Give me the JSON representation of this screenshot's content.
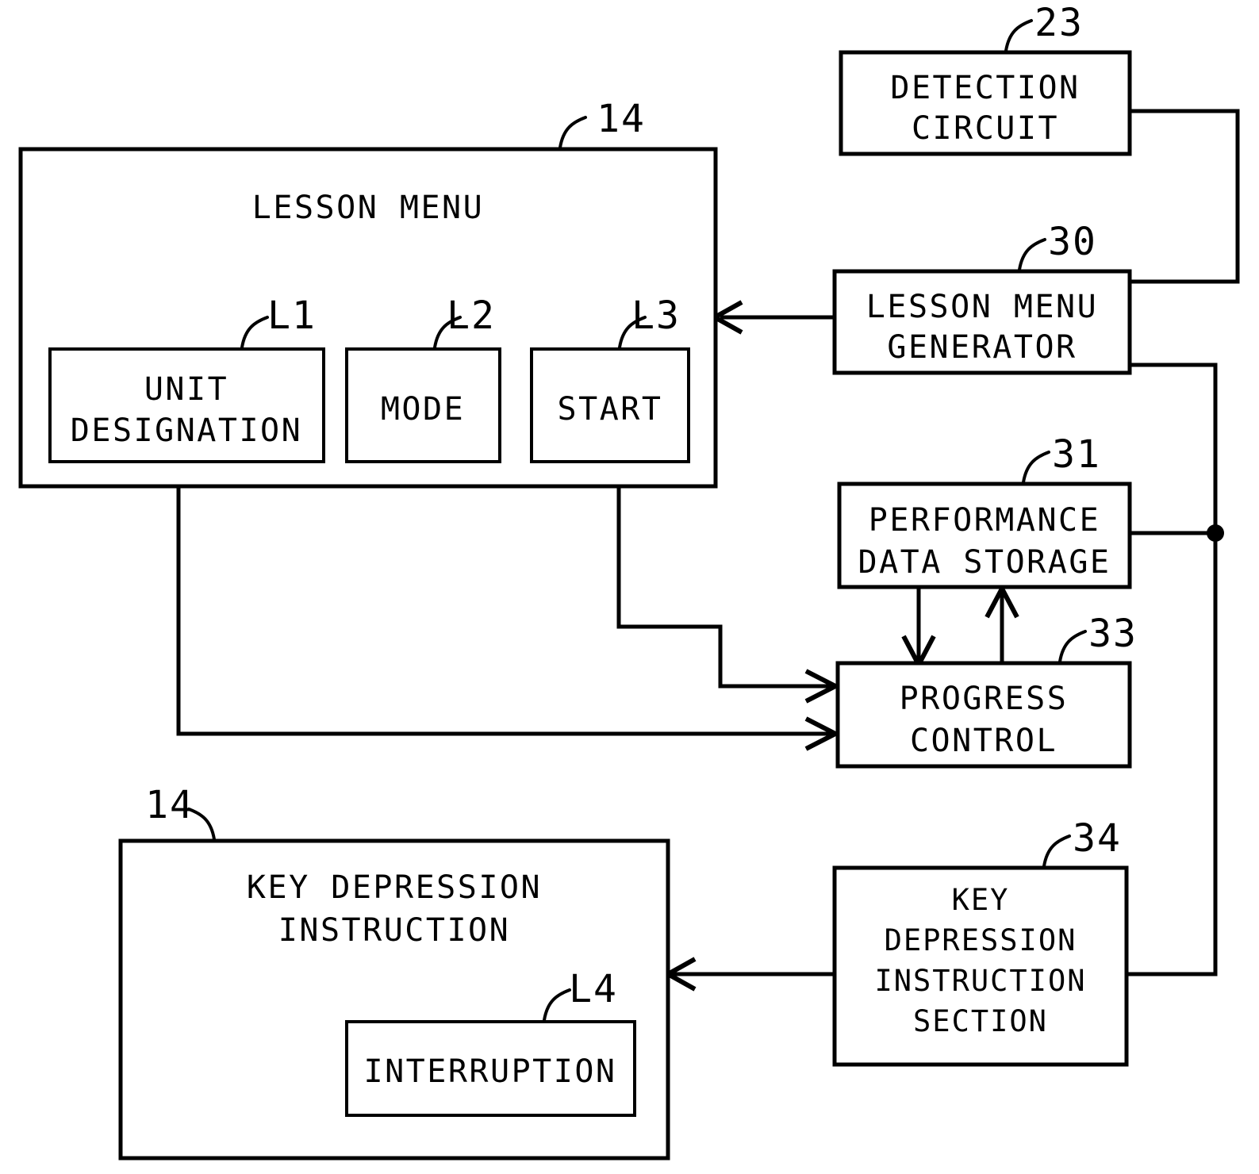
{
  "diagram": {
    "type": "patent-block-diagram",
    "background_color": "#ffffff",
    "line_color": "#000000",
    "blocks": {
      "lesson_menu_panel": {
        "ref": "14",
        "title": "LESSON MENU",
        "children": {
          "unit_designation": {
            "ref": "L1",
            "line1": "UNIT",
            "line2": "DESIGNATION"
          },
          "mode": {
            "ref": "L2",
            "label": "MODE"
          },
          "start": {
            "ref": "L3",
            "label": "START"
          }
        }
      },
      "key_depression_panel": {
        "ref": "14",
        "title_line1": "KEY DEPRESSION",
        "title_line2": "INSTRUCTION",
        "children": {
          "interruption": {
            "ref": "L4",
            "label": "INTERRUPTION"
          }
        }
      },
      "detection_circuit": {
        "ref": "23",
        "line1": "DETECTION",
        "line2": "CIRCUIT"
      },
      "lesson_menu_generator": {
        "ref": "30",
        "line1": "LESSON MENU",
        "line2": "GENERATOR"
      },
      "performance_data_storage": {
        "ref": "31",
        "line1": "PERFORMANCE",
        "line2": "DATA STORAGE"
      },
      "progress_control": {
        "ref": "33",
        "line1": "PROGRESS",
        "line2": "CONTROL"
      },
      "key_depression_instruction_section": {
        "ref": "34",
        "line1": "KEY",
        "line2": "DEPRESSION",
        "line3": "INSTRUCTION",
        "line4": "SECTION"
      }
    }
  }
}
